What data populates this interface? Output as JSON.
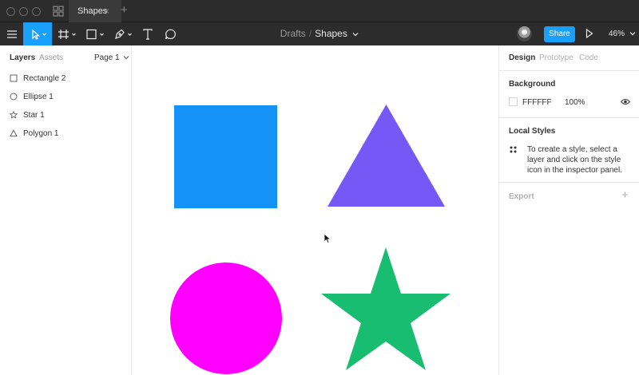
{
  "titlebar": {
    "tab_title": "Shapes",
    "tab_close": "×",
    "tab_add": "+"
  },
  "toolbar": {
    "tools": [
      "menu-icon",
      "move-icon",
      "frame-icon",
      "rectangle-icon",
      "pen-icon",
      "text-icon",
      "comment-icon"
    ],
    "breadcrumb_parent": "Drafts",
    "breadcrumb_separator": "/",
    "file_name": "Shapes",
    "share_label": "Share",
    "zoom_level": "46%",
    "colors": {
      "bar": "#2c2c2c",
      "accent": "#18a0fb"
    }
  },
  "left_panel": {
    "tabs": [
      {
        "label": "Layers",
        "active": true
      },
      {
        "label": "Assets",
        "active": false
      }
    ],
    "page_selector": "Page 1",
    "layers": [
      {
        "name": "Rectangle 2",
        "icon": "rectangle-layer-icon"
      },
      {
        "name": "Ellipse 1",
        "icon": "ellipse-layer-icon"
      },
      {
        "name": "Star 1",
        "icon": "star-layer-icon"
      },
      {
        "name": "Polygon 1",
        "icon": "polygon-layer-icon"
      }
    ]
  },
  "canvas": {
    "shapes": [
      {
        "name": "Rectangle 2",
        "fill": "#1592f5"
      },
      {
        "name": "Polygon 1",
        "fill": "#7459f7"
      },
      {
        "name": "Ellipse 1",
        "fill": "#ff00ff"
      },
      {
        "name": "Star 1",
        "fill": "#18bd71"
      }
    ]
  },
  "right_panel": {
    "tabs": [
      {
        "label": "Design",
        "active": true
      },
      {
        "label": "Prototype",
        "active": false
      },
      {
        "label": "Code",
        "active": false
      }
    ],
    "background_title": "Background",
    "background_color": "FFFFFF",
    "background_opacity": "100%",
    "local_styles_title": "Local Styles",
    "local_styles_help": "To create a style, select a layer and click on the style icon in the inspector panel.",
    "export_title": "Export",
    "export_add": "+"
  }
}
